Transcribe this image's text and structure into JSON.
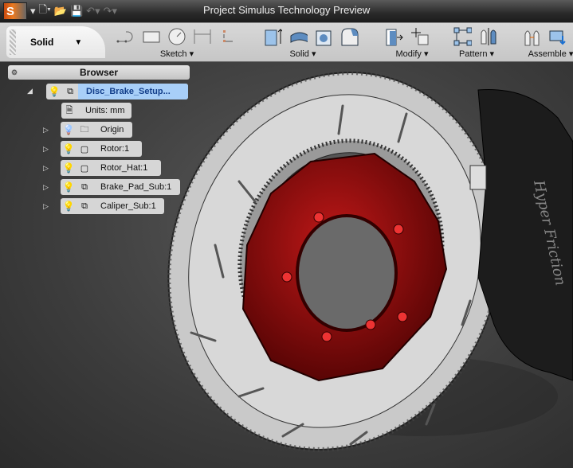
{
  "titlebar": {
    "title": "Project Simulus Technology Preview",
    "logo": "S"
  },
  "ribbon": {
    "mode": "Solid",
    "groups": [
      {
        "label": "Sketch"
      },
      {
        "label": "Solid"
      },
      {
        "label": "Modify"
      },
      {
        "label": "Pattern"
      },
      {
        "label": "Assemble"
      }
    ]
  },
  "browser": {
    "title": "Browser",
    "root": "Disc_Brake_Setup...",
    "units": "Units: mm",
    "items": [
      {
        "label": "Origin"
      },
      {
        "label": "Rotor:1"
      },
      {
        "label": "Rotor_Hat:1"
      },
      {
        "label": "Brake_Pad_Sub:1"
      },
      {
        "label": "Caliper_Sub:1"
      }
    ]
  },
  "viewport": {
    "caliper_text": "Hyper Friction"
  },
  "colors": {
    "hat": "#8a0a0a",
    "selection": "#a8cff8"
  }
}
